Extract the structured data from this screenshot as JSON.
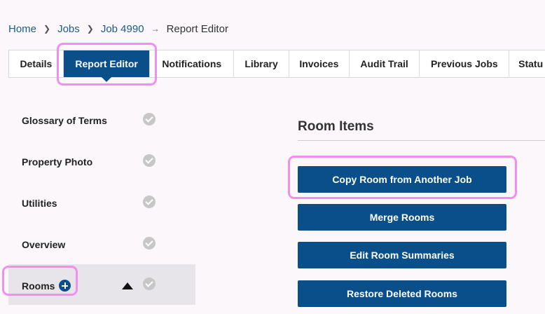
{
  "breadcrumb": {
    "home": "Home",
    "jobs": "Jobs",
    "job": "Job 4990",
    "current": "Report Editor"
  },
  "tabs": [
    {
      "label": "Details"
    },
    {
      "label": "Report Editor",
      "active": true
    },
    {
      "label": "Notifications"
    },
    {
      "label": "Library"
    },
    {
      "label": "Invoices"
    },
    {
      "label": "Audit Trail"
    },
    {
      "label": "Previous Jobs"
    },
    {
      "label": "Statu"
    }
  ],
  "sidebar": {
    "items": [
      {
        "label": "Glossary of Terms",
        "icon": "check-circle-icon"
      },
      {
        "label": "Property Photo",
        "icon": "check-circle-icon"
      },
      {
        "label": "Utilities",
        "icon": "check-circle-icon"
      },
      {
        "label": "Overview",
        "icon": "check-circle-icon"
      },
      {
        "label": "Rooms",
        "icon": "check-circle-icon",
        "expanded": true
      }
    ]
  },
  "main": {
    "section_title": "Room Items",
    "buttons": [
      {
        "label": "Copy Room from Another Job"
      },
      {
        "label": "Merge Rooms"
      },
      {
        "label": "Edit Room Summaries"
      },
      {
        "label": "Restore Deleted Rooms"
      }
    ]
  },
  "colors": {
    "primary": "#0b4f8a",
    "highlight": "#f28ef2",
    "check": "#c7c7c7",
    "background": "#fbf7fb"
  }
}
